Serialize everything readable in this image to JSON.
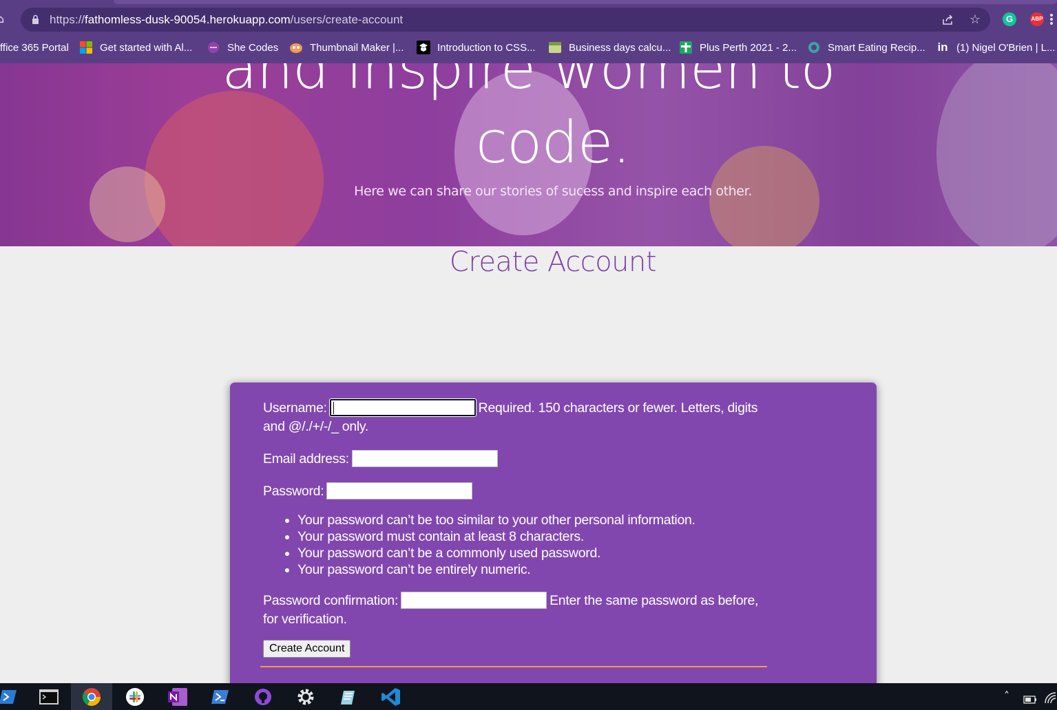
{
  "browser": {
    "url_scheme": "https://",
    "url_host": "fathomless-dusk-90054.herokuapp.com",
    "url_path": "/users/create-account",
    "bookmarks": [
      {
        "label": "ffice 365 Portal",
        "icon": "office-icon"
      },
      {
        "label": "Get started with Al...",
        "icon": "microsoft-icon"
      },
      {
        "label": "She Codes",
        "icon": "shecodes-icon"
      },
      {
        "label": "Thumbnail Maker |...",
        "icon": "thumbnail-maker-icon"
      },
      {
        "label": "Introduction to CSS...",
        "icon": "css-intro-icon"
      },
      {
        "label": "Business days calcu...",
        "icon": "calculator-icon"
      },
      {
        "label": "Plus Perth 2021 - 2...",
        "icon": "sheets-icon"
      },
      {
        "label": "Smart Eating Recip...",
        "icon": "recipe-icon"
      },
      {
        "label": "(1) Nigel O'Brien | L...",
        "icon": "linkedin-icon"
      }
    ],
    "extensions": {
      "grammarly": "G",
      "adblock": "ABP"
    }
  },
  "hero": {
    "line1": "and inspire women to",
    "line2": "code.",
    "subtitle": "Here we can share our stories of sucess and inspire each other."
  },
  "page": {
    "title": "Create Account"
  },
  "form": {
    "username_label": "Username:",
    "username_help": "Required. 150 characters or fewer. Letters, digits and @/./+/-/_ only.",
    "email_label": "Email address:",
    "password_label": "Password:",
    "password_rules": [
      "Your password can’t be too similar to your other personal information.",
      "Your password must contain at least 8 characters.",
      "Your password can’t be a commonly used password.",
      "Your password can’t be entirely numeric."
    ],
    "confirm_label": "Password confirmation:",
    "confirm_help": "Enter the same password as before, for verification.",
    "submit_label": "Create Account",
    "username_value": "",
    "email_value": "",
    "password_value": "",
    "confirm_value": ""
  },
  "taskbar": {
    "apps": [
      "powershell-icon",
      "terminal-icon",
      "chrome-icon",
      "slack-icon",
      "onenote-icon",
      "azure-powershell-icon",
      "github-desktop-icon",
      "settings-icon",
      "notepad-icon",
      "vscode-icon"
    ],
    "active_app": "chrome-icon"
  },
  "colors": {
    "chrome_bg": "#5a3e85",
    "hero_overlay": "#9a4aa3",
    "title_purple": "#7b3fa8",
    "form_bg": "#8147af",
    "accent_orange": "#f0a23b"
  }
}
